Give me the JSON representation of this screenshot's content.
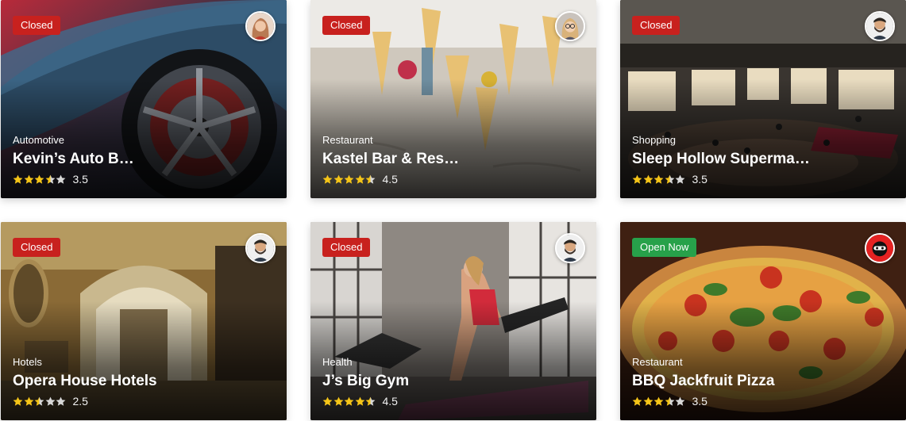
{
  "colors": {
    "closed_badge": "#c8211e",
    "open_badge": "#27a14a",
    "star_filled": "#f5c518",
    "star_empty": "#d8d8d8"
  },
  "listings": [
    {
      "status": "Closed",
      "category": "Automotive",
      "title": "Kevin’s Auto B…",
      "rating": 3.5,
      "rating_text": "3.5",
      "image": "sports-car-wheel",
      "avatar": "woman-avatar"
    },
    {
      "status": "Closed",
      "category": "Restaurant",
      "title": "Kastel Bar & Res…",
      "rating": 4.5,
      "rating_text": "4.5",
      "image": "restaurant-table-setting",
      "avatar": "woman-glasses-avatar"
    },
    {
      "status": "Closed",
      "category": "Shopping",
      "title": "Sleep Hollow Superma…",
      "rating": 3.5,
      "rating_text": "3.5",
      "image": "shopping-mall",
      "avatar": "bearded-man-avatar"
    },
    {
      "status": "Closed",
      "category": "Hotels",
      "title": "Opera House Hotels",
      "rating": 2.5,
      "rating_text": "2.5",
      "image": "hotel-hallway",
      "avatar": "bearded-man-avatar"
    },
    {
      "status": "Closed",
      "category": "Health",
      "title": "J’s Big Gym",
      "rating": 4.5,
      "rating_text": "4.5",
      "image": "gym-workout",
      "avatar": "bearded-man-avatar"
    },
    {
      "status": "Open Now",
      "category": "Restaurant",
      "title": "BBQ Jackfruit Pizza",
      "rating": 3.5,
      "rating_text": "3.5",
      "image": "pizza",
      "avatar": "ninja-avatar"
    }
  ]
}
